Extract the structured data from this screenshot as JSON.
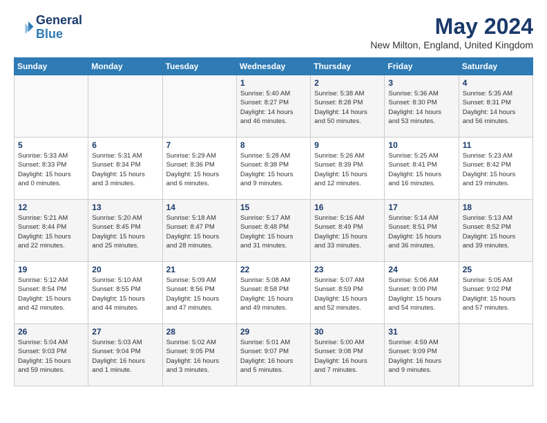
{
  "header": {
    "logo_line1": "General",
    "logo_line2": "Blue",
    "month_year": "May 2024",
    "location": "New Milton, England, United Kingdom"
  },
  "weekdays": [
    "Sunday",
    "Monday",
    "Tuesday",
    "Wednesday",
    "Thursday",
    "Friday",
    "Saturday"
  ],
  "weeks": [
    [
      {
        "day": "",
        "info": ""
      },
      {
        "day": "",
        "info": ""
      },
      {
        "day": "",
        "info": ""
      },
      {
        "day": "1",
        "info": "Sunrise: 5:40 AM\nSunset: 8:27 PM\nDaylight: 14 hours\nand 46 minutes."
      },
      {
        "day": "2",
        "info": "Sunrise: 5:38 AM\nSunset: 8:28 PM\nDaylight: 14 hours\nand 50 minutes."
      },
      {
        "day": "3",
        "info": "Sunrise: 5:36 AM\nSunset: 8:30 PM\nDaylight: 14 hours\nand 53 minutes."
      },
      {
        "day": "4",
        "info": "Sunrise: 5:35 AM\nSunset: 8:31 PM\nDaylight: 14 hours\nand 56 minutes."
      }
    ],
    [
      {
        "day": "5",
        "info": "Sunrise: 5:33 AM\nSunset: 8:33 PM\nDaylight: 15 hours\nand 0 minutes."
      },
      {
        "day": "6",
        "info": "Sunrise: 5:31 AM\nSunset: 8:34 PM\nDaylight: 15 hours\nand 3 minutes."
      },
      {
        "day": "7",
        "info": "Sunrise: 5:29 AM\nSunset: 8:36 PM\nDaylight: 15 hours\nand 6 minutes."
      },
      {
        "day": "8",
        "info": "Sunrise: 5:28 AM\nSunset: 8:38 PM\nDaylight: 15 hours\nand 9 minutes."
      },
      {
        "day": "9",
        "info": "Sunrise: 5:26 AM\nSunset: 8:39 PM\nDaylight: 15 hours\nand 12 minutes."
      },
      {
        "day": "10",
        "info": "Sunrise: 5:25 AM\nSunset: 8:41 PM\nDaylight: 15 hours\nand 16 minutes."
      },
      {
        "day": "11",
        "info": "Sunrise: 5:23 AM\nSunset: 8:42 PM\nDaylight: 15 hours\nand 19 minutes."
      }
    ],
    [
      {
        "day": "12",
        "info": "Sunrise: 5:21 AM\nSunset: 8:44 PM\nDaylight: 15 hours\nand 22 minutes."
      },
      {
        "day": "13",
        "info": "Sunrise: 5:20 AM\nSunset: 8:45 PM\nDaylight: 15 hours\nand 25 minutes."
      },
      {
        "day": "14",
        "info": "Sunrise: 5:18 AM\nSunset: 8:47 PM\nDaylight: 15 hours\nand 28 minutes."
      },
      {
        "day": "15",
        "info": "Sunrise: 5:17 AM\nSunset: 8:48 PM\nDaylight: 15 hours\nand 31 minutes."
      },
      {
        "day": "16",
        "info": "Sunrise: 5:16 AM\nSunset: 8:49 PM\nDaylight: 15 hours\nand 33 minutes."
      },
      {
        "day": "17",
        "info": "Sunrise: 5:14 AM\nSunset: 8:51 PM\nDaylight: 15 hours\nand 36 minutes."
      },
      {
        "day": "18",
        "info": "Sunrise: 5:13 AM\nSunset: 8:52 PM\nDaylight: 15 hours\nand 39 minutes."
      }
    ],
    [
      {
        "day": "19",
        "info": "Sunrise: 5:12 AM\nSunset: 8:54 PM\nDaylight: 15 hours\nand 42 minutes."
      },
      {
        "day": "20",
        "info": "Sunrise: 5:10 AM\nSunset: 8:55 PM\nDaylight: 15 hours\nand 44 minutes."
      },
      {
        "day": "21",
        "info": "Sunrise: 5:09 AM\nSunset: 8:56 PM\nDaylight: 15 hours\nand 47 minutes."
      },
      {
        "day": "22",
        "info": "Sunrise: 5:08 AM\nSunset: 8:58 PM\nDaylight: 15 hours\nand 49 minutes."
      },
      {
        "day": "23",
        "info": "Sunrise: 5:07 AM\nSunset: 8:59 PM\nDaylight: 15 hours\nand 52 minutes."
      },
      {
        "day": "24",
        "info": "Sunrise: 5:06 AM\nSunset: 9:00 PM\nDaylight: 15 hours\nand 54 minutes."
      },
      {
        "day": "25",
        "info": "Sunrise: 5:05 AM\nSunset: 9:02 PM\nDaylight: 15 hours\nand 57 minutes."
      }
    ],
    [
      {
        "day": "26",
        "info": "Sunrise: 5:04 AM\nSunset: 9:03 PM\nDaylight: 15 hours\nand 59 minutes."
      },
      {
        "day": "27",
        "info": "Sunrise: 5:03 AM\nSunset: 9:04 PM\nDaylight: 16 hours\nand 1 minute."
      },
      {
        "day": "28",
        "info": "Sunrise: 5:02 AM\nSunset: 9:05 PM\nDaylight: 16 hours\nand 3 minutes."
      },
      {
        "day": "29",
        "info": "Sunrise: 5:01 AM\nSunset: 9:07 PM\nDaylight: 16 hours\nand 5 minutes."
      },
      {
        "day": "30",
        "info": "Sunrise: 5:00 AM\nSunset: 9:08 PM\nDaylight: 16 hours\nand 7 minutes."
      },
      {
        "day": "31",
        "info": "Sunrise: 4:59 AM\nSunset: 9:09 PM\nDaylight: 16 hours\nand 9 minutes."
      },
      {
        "day": "",
        "info": ""
      }
    ]
  ]
}
